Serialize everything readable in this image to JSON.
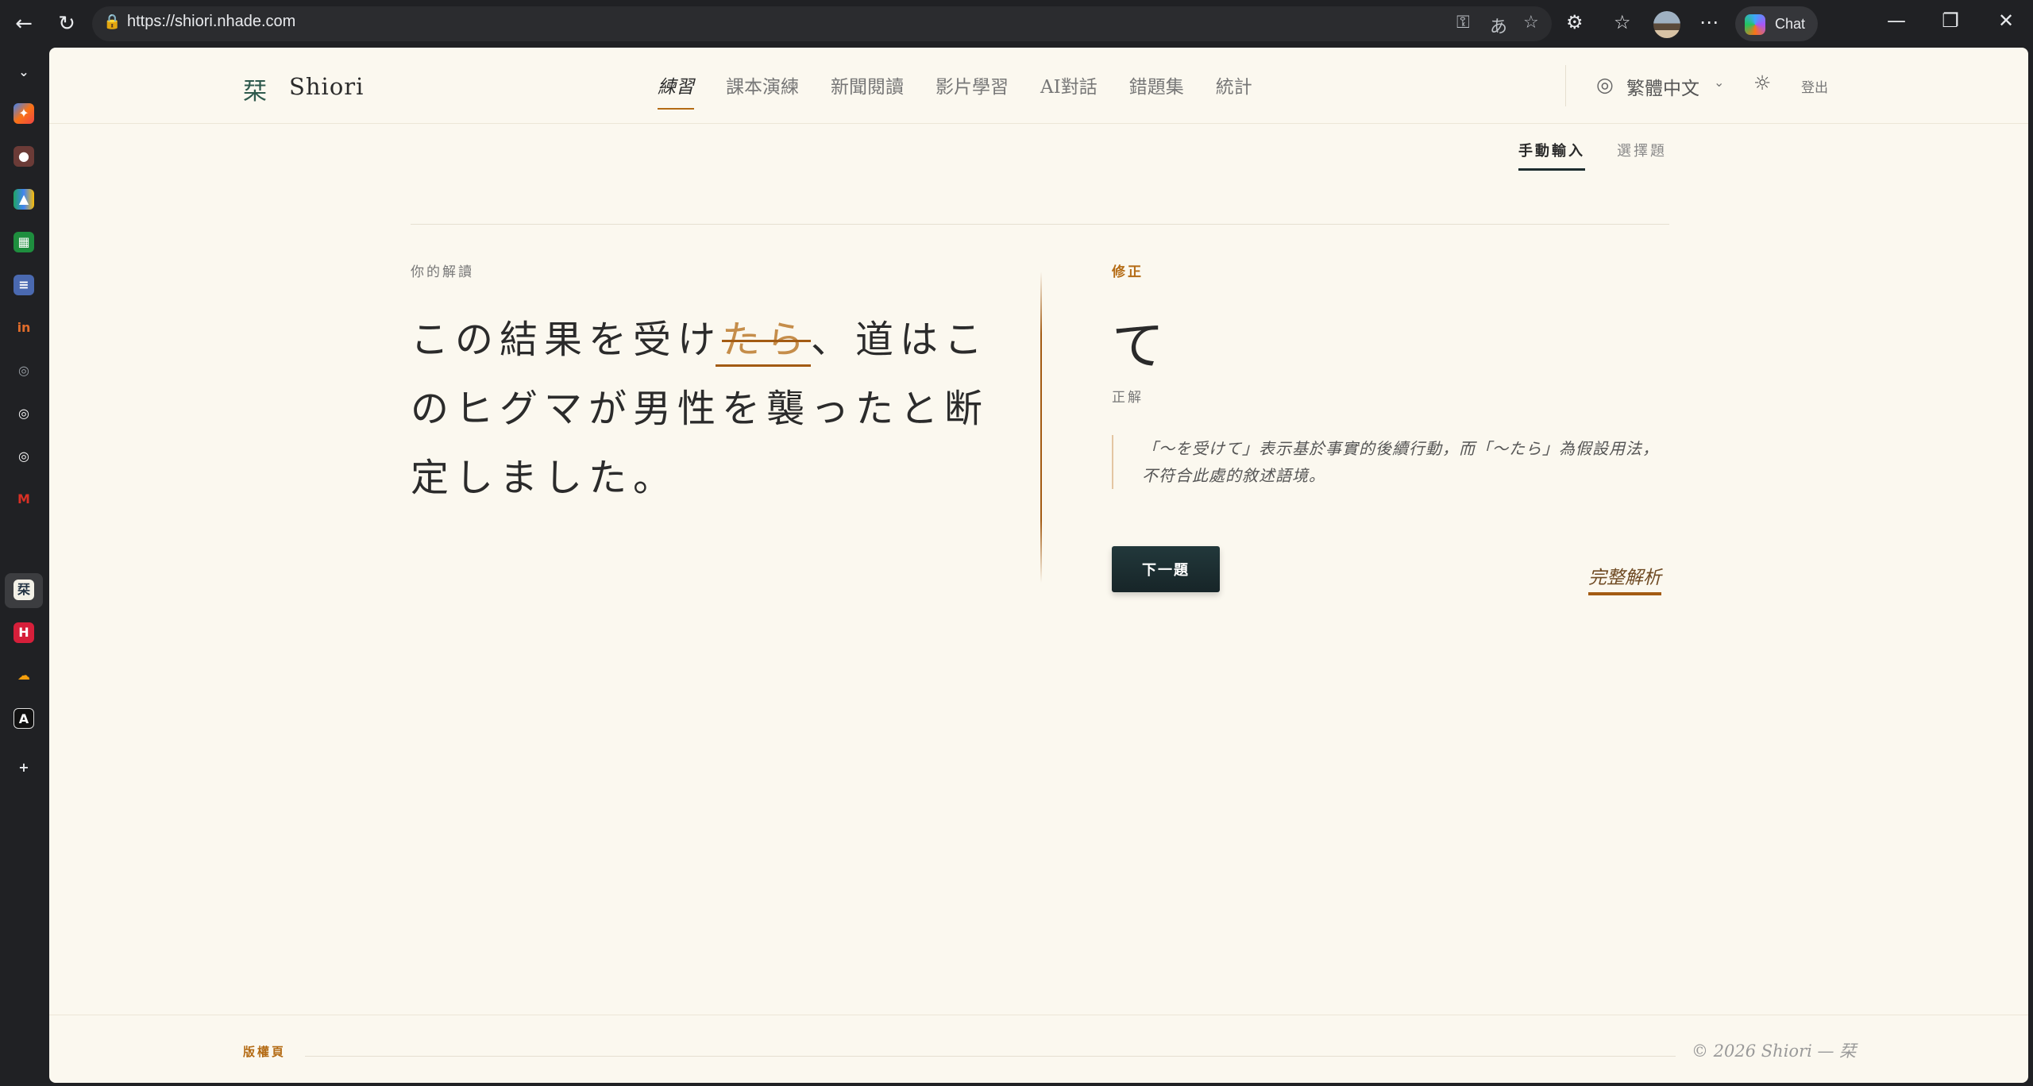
{
  "browser": {
    "url": "https://shiori.nhade.com",
    "chat_label": "Chat",
    "icons": [
      "back-arrow-icon",
      "refresh-icon",
      "lock-icon",
      "key-icon",
      "translate-icon",
      "star-icon",
      "extensions-icon",
      "favorites-icon",
      "more-icon",
      "minimize-icon",
      "restore-icon",
      "close-icon"
    ]
  },
  "sidebar": {
    "items": [
      "chevron-down-icon",
      "copilot-icon",
      "record-icon",
      "drive-icon",
      "sheets-icon",
      "docs-icon",
      "in-icon",
      "github-icon",
      "github-icon",
      "github-icon",
      "gmail-icon",
      "shiori-icon",
      "h-icon",
      "cloud-icon",
      "a-icon",
      "add-icon"
    ]
  },
  "site": {
    "logo_mark": "栞",
    "logo_text": "Shiori",
    "nav": [
      "練習",
      "課本演練",
      "新聞閱讀",
      "影片學習",
      "AI對話",
      "錯題集",
      "統計"
    ],
    "language": "繁體中文",
    "logout": "登出"
  },
  "practice": {
    "tabs": [
      "手動輸入",
      "選擇題"
    ],
    "your_reading_label": "你的解讀",
    "answer_before": "この結果を受け",
    "wrong_part": "たら",
    "answer_after": "、道はこのヒグマが男性を襲ったと断定しました。",
    "correction_label": "修正",
    "correction": "て",
    "correct_label": "正解",
    "explanation": "「〜を受けて」表示基於事實的後續行動，而「〜たら」為假設用法，不符合此處的敘述語境。",
    "next_button": "下一題",
    "full_analysis": "完整解析"
  },
  "footer": {
    "left": "版權頁",
    "right": "© 2026 Shiori — 栞"
  },
  "colors": {
    "background": "#fbf8ef",
    "accent": "#b46b14",
    "dark_button": "#1d2c2d"
  }
}
